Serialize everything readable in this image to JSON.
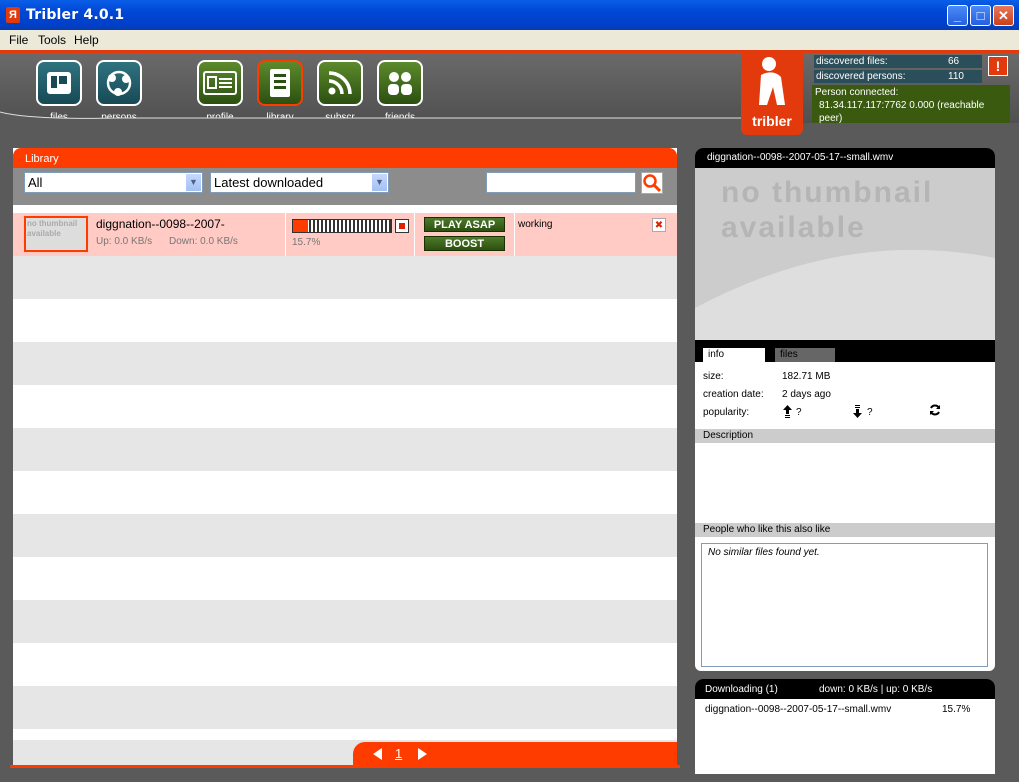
{
  "window": {
    "title": "Tribler 4.0.1",
    "icon_glyph": "Я",
    "min": "_",
    "max": "□",
    "close": "✕"
  },
  "menu": [
    "File",
    "Tools",
    "Help"
  ],
  "toolbar": {
    "items": [
      {
        "label": "files",
        "icon": "files-icon"
      },
      {
        "label": "persons",
        "icon": "persons-icon"
      },
      {
        "label": "profile",
        "icon": "profile-icon"
      },
      {
        "label": "library",
        "icon": "library-icon"
      },
      {
        "label": "subscr",
        "icon": "rss-icon"
      },
      {
        "label": "friends",
        "icon": "friends-icon"
      }
    ]
  },
  "logo": {
    "word": "tribler",
    "glyph": "Я"
  },
  "stats": {
    "discovered_files_label": "discovered files:",
    "discovered_files_value": "66",
    "discovered_persons_label": "discovered persons:",
    "discovered_persons_value": "110",
    "alert": "!",
    "person_connected_label": "Person connected:",
    "person_connected_value": "81.34.117.117:7762 0.000 (reachable peer)"
  },
  "library": {
    "title": "Library",
    "filter_category": "All",
    "filter_sort": "Latest downloaded",
    "search_value": "",
    "row": {
      "thumb_text1": "no thumbnail",
      "thumb_text2": "available",
      "name": "diggnation--0098--2007-",
      "up": "Up: 0.0 KB/s",
      "down": "Down: 0.0 KB/s",
      "progress_pct": "15.7%",
      "progress_fraction": 0.157,
      "play_label": "PLAY ASAP",
      "boost_label": "BOOST",
      "status": "working",
      "remove": "✖"
    },
    "page": "1"
  },
  "detail": {
    "title": "diggnation--0098--2007-05-17--small.wmv",
    "thumb_line1": "no thumbnail",
    "thumb_line2": "available",
    "tab_info": "info",
    "tab_files": "files",
    "size_label": "size:",
    "size_value": "182.71 MB",
    "creation_label": "creation date:",
    "creation_value": "2 days ago",
    "popularity_label": "popularity:",
    "seeders": "?",
    "leechers": "?",
    "description_label": "Description",
    "similar_label": "People who like this also like",
    "similar_empty": "No similar files found yet."
  },
  "downloading": {
    "title": "Downloading (1)",
    "rates": "down: 0 KB/s | up: 0 KB/s",
    "items": [
      {
        "name": "diggnation--0098--2007-05-17--small.wmv",
        "pct": "15.7%"
      }
    ]
  },
  "colors": {
    "accent": "#ff3c00",
    "teal": "#174a55",
    "olive": "#2c5010"
  }
}
